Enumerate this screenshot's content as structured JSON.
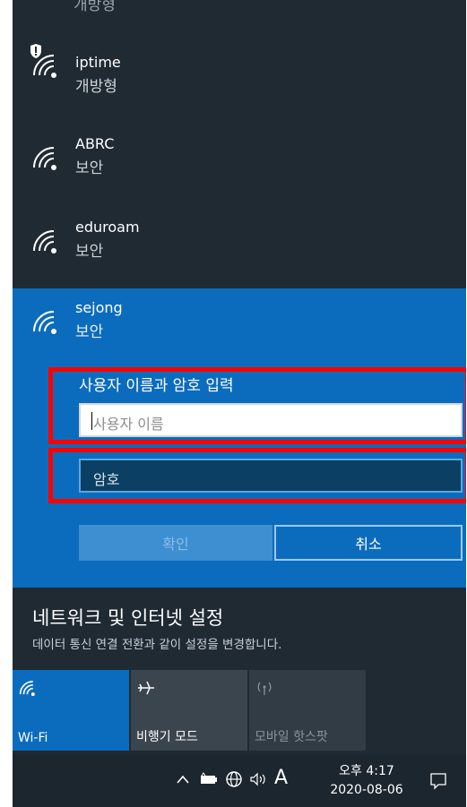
{
  "clipped_top_label": "개방형",
  "networks": [
    {
      "name": "iptime",
      "status": "개방형"
    },
    {
      "name": "ABRC",
      "status": "보안"
    },
    {
      "name": "eduroam",
      "status": "보안"
    }
  ],
  "selected_network": {
    "name": "sejong",
    "status": "보안",
    "prompt": "사용자 이름과 암호 입력",
    "username_placeholder": "사용자 이름",
    "password_placeholder": "암호",
    "confirm_label": "확인",
    "cancel_label": "취소"
  },
  "settings": {
    "title": "네트워크 및 인터넷 설정",
    "description": "데이터 통신 연결 전환과 같이 설정을 변경합니다."
  },
  "quick_actions": [
    {
      "label": "Wi-Fi",
      "icon": "wifi-icon",
      "active": true
    },
    {
      "label": "비행기 모드",
      "icon": "airplane-icon",
      "active": false
    },
    {
      "label": "모바일 핫스팟",
      "icon": "hotspot-icon",
      "active": false,
      "disabled": true
    }
  ],
  "taskbar": {
    "ime_indicator": "A",
    "time": "오후 4:17",
    "date": "2020-08-06"
  },
  "colors": {
    "panel_bg": "#202a33",
    "accent": "#0b6cbd",
    "highlight": "#ff0000"
  }
}
